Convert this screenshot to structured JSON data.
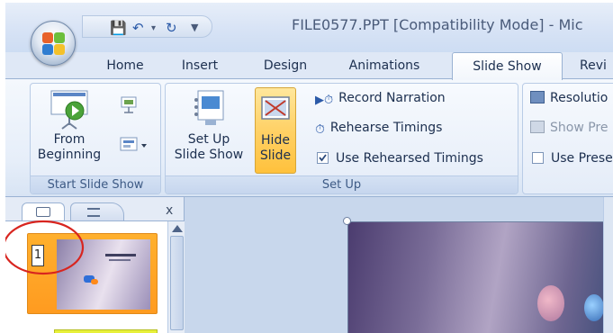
{
  "window": {
    "title": "FILE0577.PPT [Compatibility Mode] - Mic"
  },
  "quick_access": {
    "icons": [
      "save-icon",
      "undo-icon",
      "redo-icon",
      "customize-icon"
    ]
  },
  "tabs": [
    {
      "label": "Home"
    },
    {
      "label": "Insert"
    },
    {
      "label": "Design"
    },
    {
      "label": "Animations"
    },
    {
      "label": "Slide Show",
      "active": true
    },
    {
      "label": "Revi"
    }
  ],
  "ribbon": {
    "start_slide_show": {
      "label": "Start Slide Show",
      "from_beginning": "From\nBeginning"
    },
    "set_up": {
      "label": "Set Up",
      "set_up_slide_show": "Set Up\nSlide Show",
      "hide_slide": "Hide\nSlide",
      "record_narration": "Record Narration",
      "rehearse_timings": "Rehearse Timings",
      "use_rehearsed_timings": "Use Rehearsed Timings",
      "use_rehearsed_timings_checked": true
    },
    "monitors": {
      "resolution": "Resolutio",
      "show_presentation_on": "Show Pre",
      "use_presenter_view": "Use Prese"
    }
  },
  "slides_panel": {
    "close_symbol": "x",
    "selected_slide_number": "1"
  },
  "colors": {
    "ribbon_bg": "#e6eef9",
    "active_button": "#ffd36b",
    "accent_circle": "#d8251f"
  }
}
